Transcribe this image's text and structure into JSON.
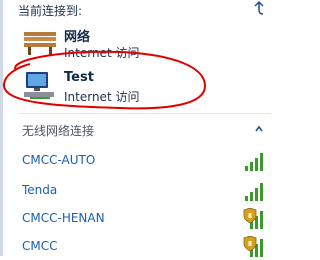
{
  "header": {
    "title": "当前连接到:"
  },
  "connections": [
    {
      "name": "网络",
      "status": "Internet 访问",
      "icon": "bench-icon"
    },
    {
      "name": "Test",
      "status": "Internet 访问",
      "icon": "network-computer-icon"
    }
  ],
  "wireless": {
    "header": "无线网络连接",
    "networks": [
      {
        "name": "CMCC-AUTO",
        "secured": false
      },
      {
        "name": "Tenda",
        "secured": false
      },
      {
        "name": "CMCC-HENAN",
        "secured": true
      },
      {
        "name": "CMCC",
        "secured": true
      }
    ]
  },
  "colors": {
    "link": "#1a5fb4",
    "signal": "#3a9a2a",
    "annotation": "#e00000",
    "shield": "#d4a020"
  }
}
